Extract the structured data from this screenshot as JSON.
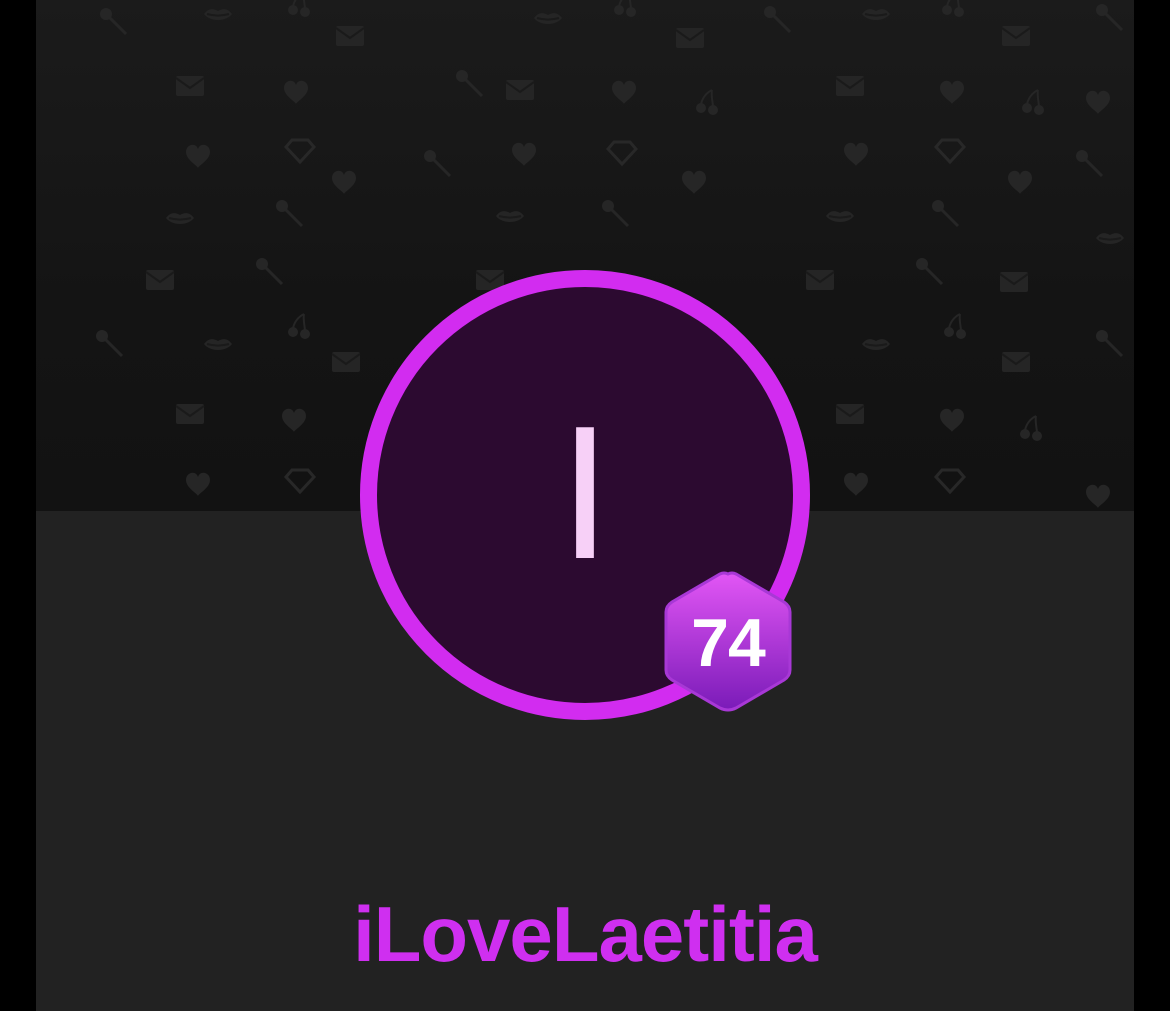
{
  "profile": {
    "avatar_initial": "I",
    "level": "74",
    "username": "iLoveLaetitia"
  },
  "cover": {
    "pattern_icons": [
      "heart-icon",
      "lips-icon",
      "cherry-icon",
      "envelope-icon",
      "rose-icon",
      "diamond-icon"
    ]
  },
  "colors": {
    "accent": "#d22cf0",
    "avatar_background": "#2c0a30",
    "avatar_letter": "#f7d0f7",
    "username": "#cf2ff0",
    "badge_top": "#e256f5",
    "badge_bottom": "#7a1bb8",
    "cover_background": "#161616",
    "page_background": "#222222"
  }
}
